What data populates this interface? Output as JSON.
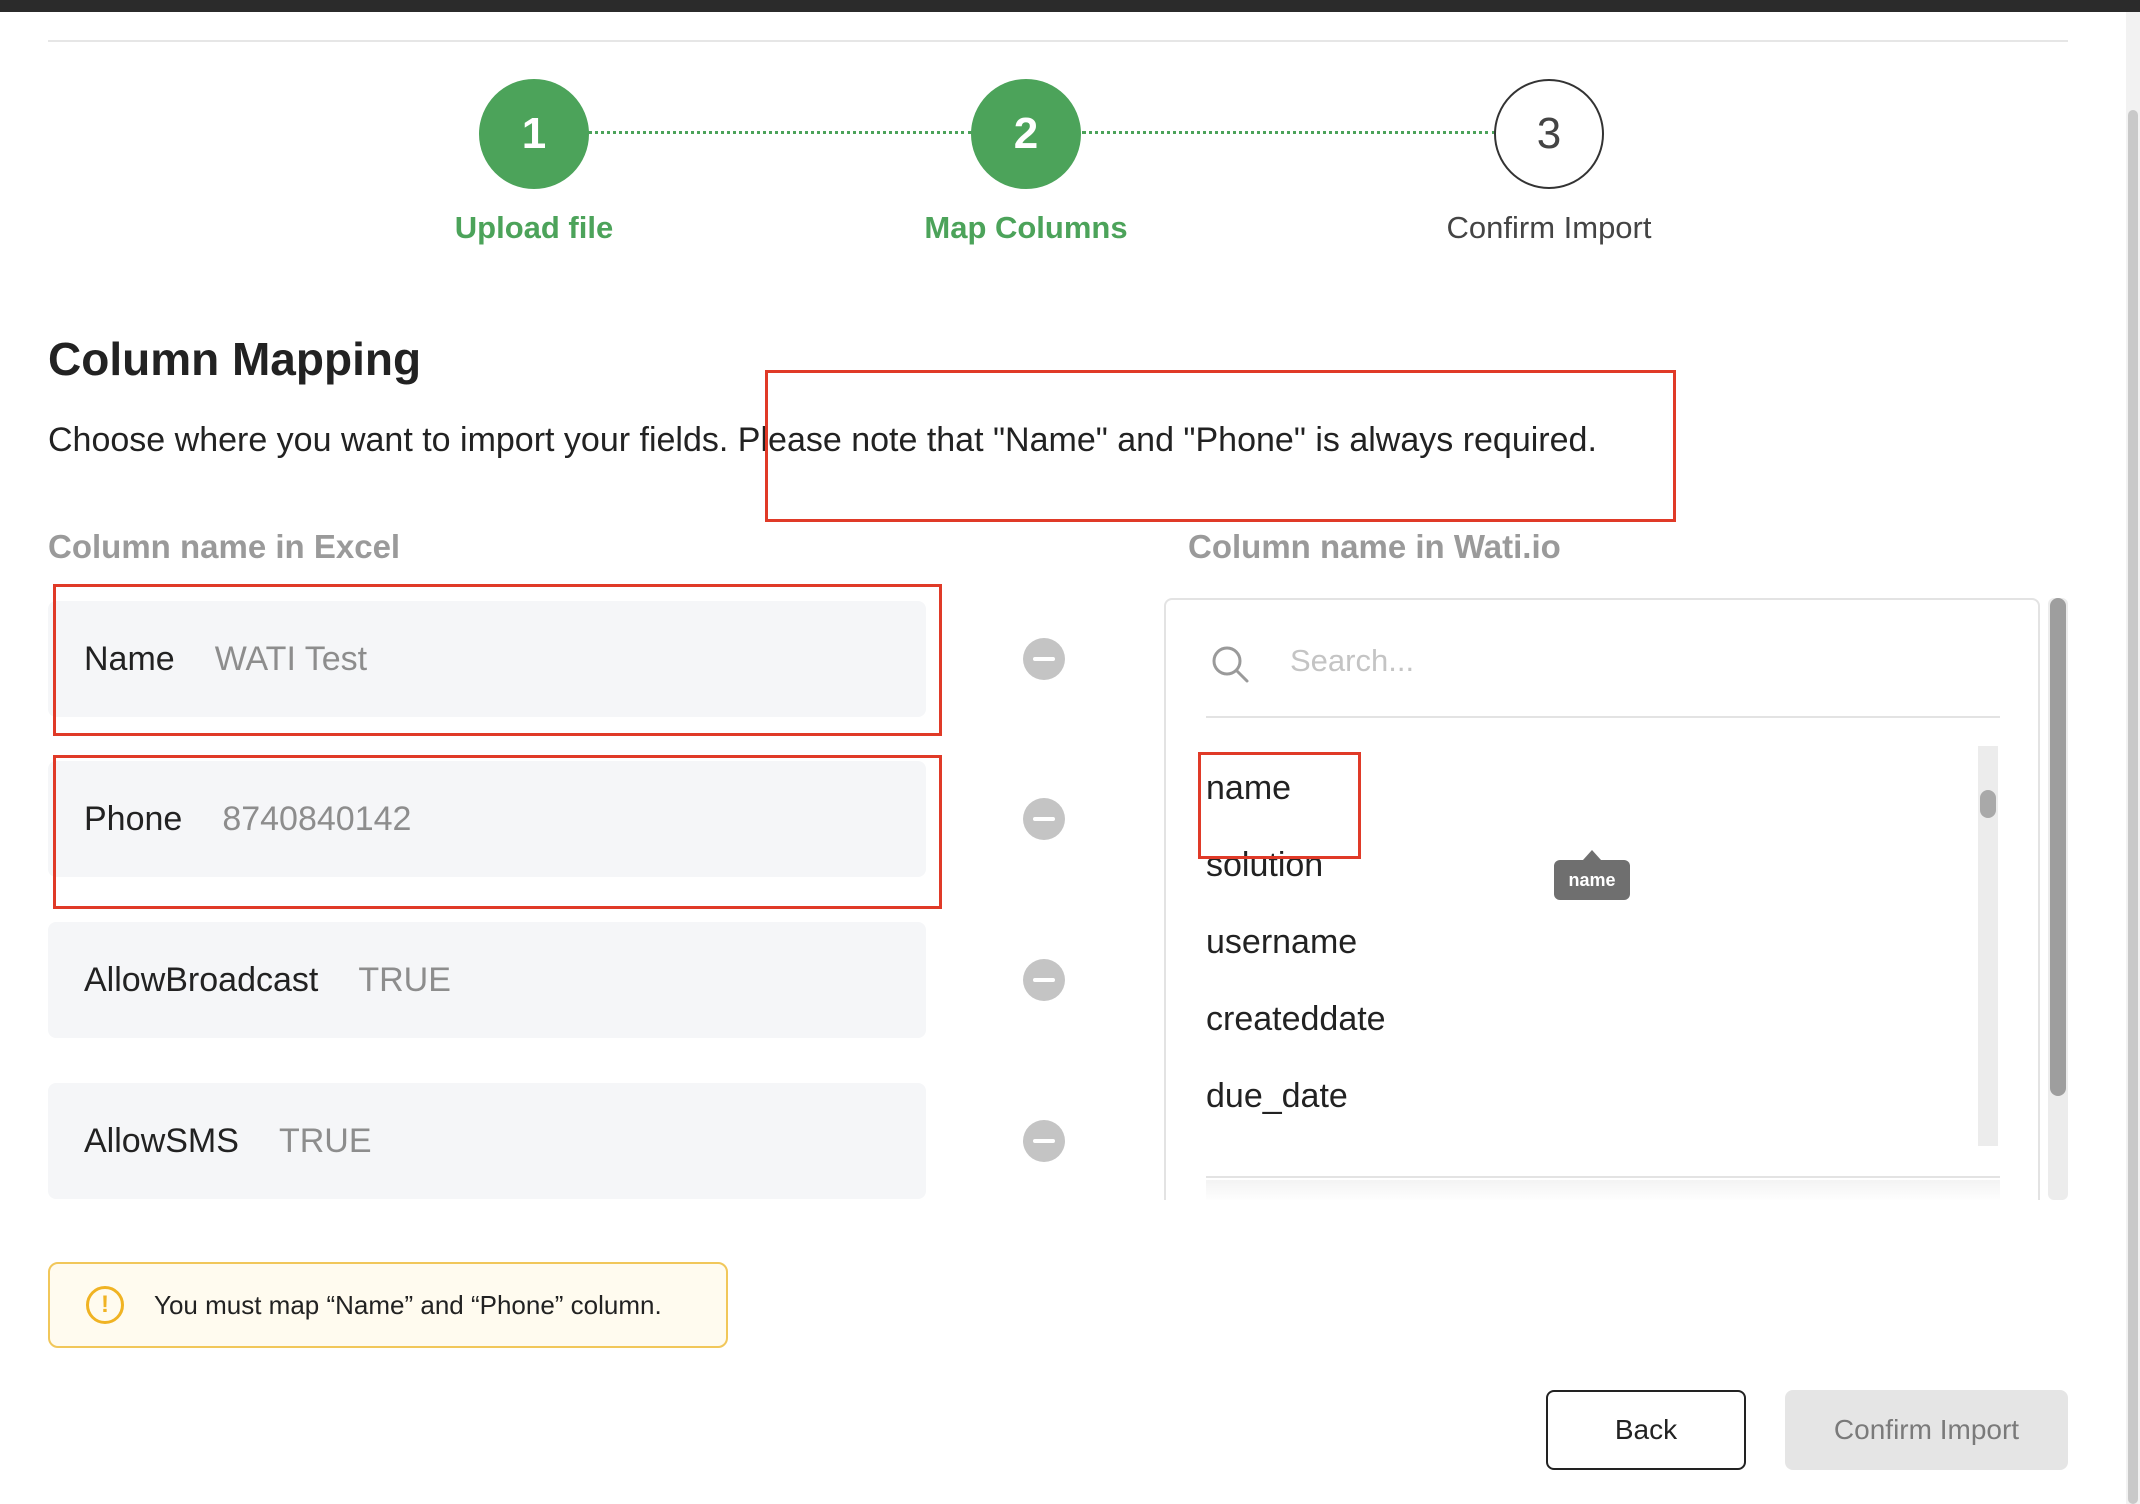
{
  "stepper": {
    "steps": [
      {
        "number": "1",
        "label": "Upload file",
        "state": "done"
      },
      {
        "number": "2",
        "label": "Map Columns",
        "state": "done"
      },
      {
        "number": "3",
        "label": "Confirm Import",
        "state": "todo"
      }
    ]
  },
  "page": {
    "title": "Column Mapping",
    "subtitle_start": "Choose where you want to import your fields.",
    "subtitle_note": "Please note that \"Name\" and \"Phone\" is always required."
  },
  "excel_column": {
    "header": "Column name in Excel",
    "rows": [
      {
        "name": "Name",
        "sample": "WATI Test"
      },
      {
        "name": "Phone",
        "sample": "8740840142"
      },
      {
        "name": "AllowBroadcast",
        "sample": "TRUE"
      },
      {
        "name": "AllowSMS",
        "sample": "TRUE"
      }
    ]
  },
  "wati_column": {
    "header": "Column name in Wati.io",
    "search_placeholder": "Search...",
    "options": [
      "name",
      "solution",
      "username",
      "createddate",
      "due_date"
    ],
    "tooltip": "name"
  },
  "warning": {
    "text": "You must map “Name” and “Phone” column."
  },
  "actions": {
    "back_label": "Back",
    "confirm_label": "Confirm Import"
  },
  "colors": {
    "accent_green": "#4ca35a",
    "annotation_red": "#e03a28",
    "warning_yellow": "#f0b323"
  },
  "icons": {
    "search": "search-icon",
    "warning": "warning-icon",
    "remove": "minus-circle-icon"
  }
}
